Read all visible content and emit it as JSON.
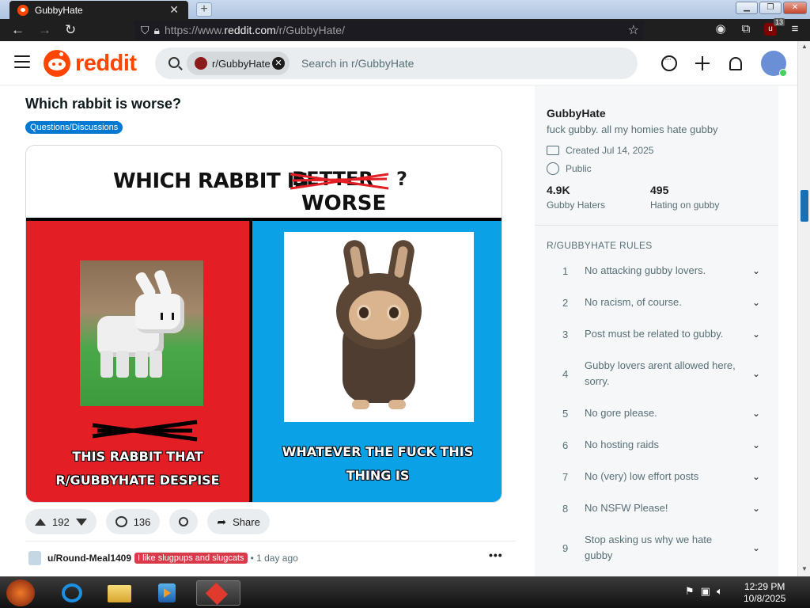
{
  "browser": {
    "tab_title": "GubbyHate",
    "tab_close": "✕",
    "new_tab": "+",
    "url_prefix": "https://www.",
    "url_domain": "reddit.com",
    "url_path": "/r/GubbyHate/",
    "extension_badge": "13",
    "window_buttons": [
      "▁",
      "❐",
      "✕"
    ]
  },
  "reddit": {
    "logo_text": "reddit",
    "search": {
      "community_chip": "r/GubbyHate",
      "placeholder": "Search in r/GubbyHate"
    }
  },
  "post": {
    "title": "Which rabbit is worse?",
    "flair": "Questions/Discussions",
    "image": {
      "headline": "WHICH RABBIT IS",
      "struck_word": "BETTER",
      "question_mark": "?",
      "replacement_word": "WORSE",
      "left_caption_line1": "THIS RABBIT THAT",
      "left_caption_line2": "R/GUBBYHATE DESPISE",
      "right_caption_line1": "WHATEVER THE FUCK THIS",
      "right_caption_line2": "THING IS"
    },
    "votes": "192",
    "comments": "136",
    "share_label": "Share"
  },
  "comment": {
    "author": "u/Round-Meal1409",
    "flair": "I like slugpups and slugcats",
    "time": "• 1 day ago",
    "more": "•••"
  },
  "sidebar": {
    "name": "GubbyHate",
    "description": "fuck gubby. all my homies hate gubby",
    "created": "Created Jul 14, 2025",
    "visibility": "Public",
    "stats": [
      {
        "value": "4.9K",
        "label": "Gubby Haters"
      },
      {
        "value": "495",
        "label": "Hating on gubby"
      }
    ],
    "rules_heading": "R/GUBBYHATE RULES",
    "rules": [
      {
        "n": "1",
        "text": "No attacking gubby lovers."
      },
      {
        "n": "2",
        "text": "No racism, of course."
      },
      {
        "n": "3",
        "text": "Post must be related to gubby."
      },
      {
        "n": "4",
        "text": "Gubby lovers arent allowed here, sorry."
      },
      {
        "n": "5",
        "text": "No gore please."
      },
      {
        "n": "6",
        "text": "No hosting raids"
      },
      {
        "n": "7",
        "text": "No (very) low effort posts"
      },
      {
        "n": "8",
        "text": "No NSFW Please!"
      },
      {
        "n": "9",
        "text": "Stop asking us why we hate gubby"
      }
    ]
  },
  "taskbar": {
    "time": "12:29 PM",
    "date": "10/8/2025"
  },
  "colors": {
    "reddit_orange": "#ff4500",
    "flair_blue": "#0079d3",
    "user_flair_red": "#d93a49",
    "panel_red": "#e31e24",
    "panel_blue": "#0aa1e6"
  }
}
